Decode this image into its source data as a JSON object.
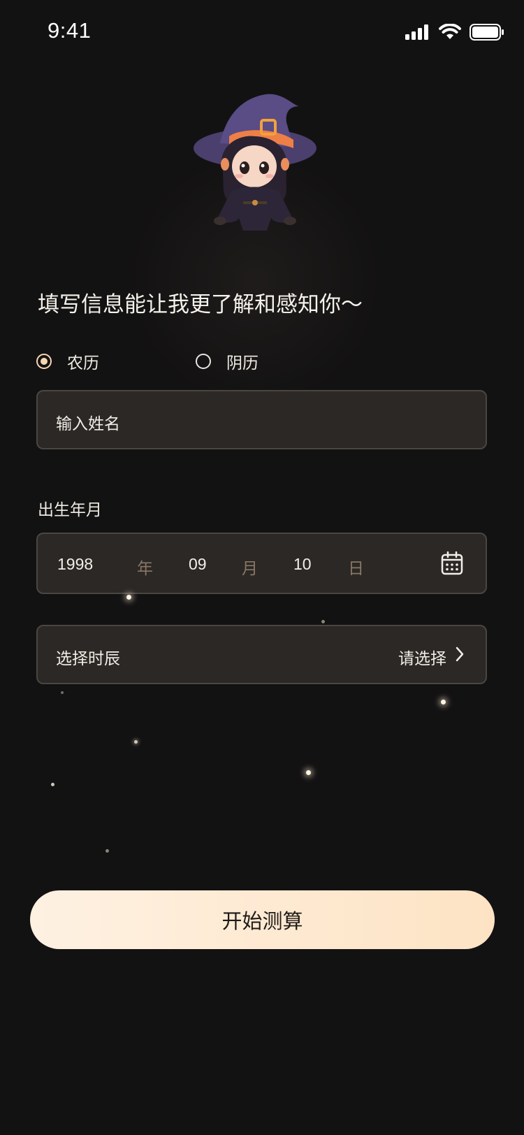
{
  "status": {
    "time": "9:41"
  },
  "headline": "填写信息能让我更了解和感知你～",
  "calendar_type": {
    "options": [
      {
        "label": "农历",
        "checked": true
      },
      {
        "label": "阴历",
        "checked": false
      }
    ]
  },
  "name_field": {
    "placeholder": "输入姓名"
  },
  "birth": {
    "label": "出生年月",
    "year": "1998",
    "year_unit": "年",
    "month": "09",
    "month_unit": "月",
    "day": "10",
    "day_unit": "日"
  },
  "hour": {
    "label": "选择时辰",
    "value": "请选择"
  },
  "submit_label": "开始测算",
  "icons": {
    "status": [
      "signal-icon",
      "wifi-icon",
      "battery-icon"
    ],
    "date": "calendar-icon",
    "hour": "chevron-right-icon"
  },
  "colors": {
    "background": "#131212",
    "field_bg": "#2b2825",
    "accent": "#f6d7b3",
    "button_start": "#fef1e2",
    "button_end": "#fde3c4"
  }
}
